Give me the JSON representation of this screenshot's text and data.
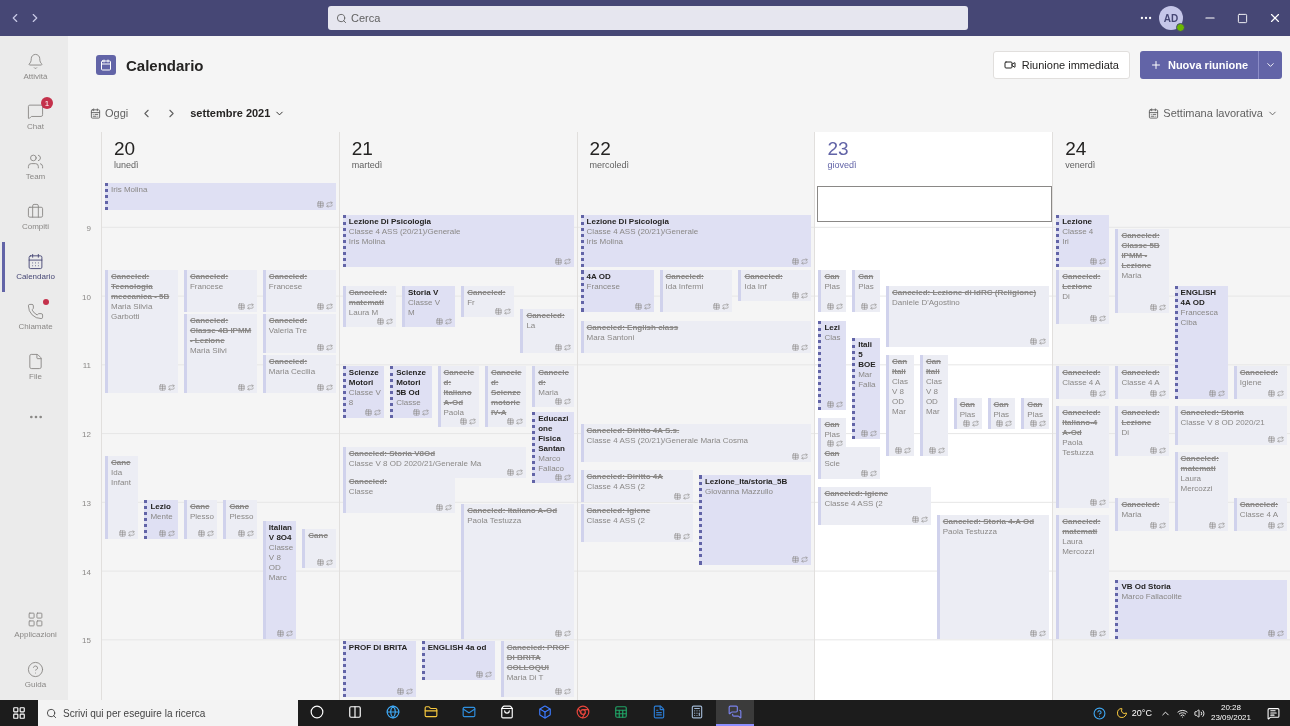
{
  "titlebar": {
    "search": {
      "placeholder": "Cerca"
    },
    "avatar": "AD"
  },
  "rail": {
    "items": [
      {
        "label": "Attività",
        "selected": false
      },
      {
        "label": "Chat",
        "selected": false,
        "badge": "1"
      },
      {
        "label": "Team",
        "selected": false
      },
      {
        "label": "Compiti",
        "selected": false
      },
      {
        "label": "Calendario",
        "selected": true
      },
      {
        "label": "Chiamate",
        "selected": false,
        "dot": true
      },
      {
        "label": "File",
        "selected": false
      }
    ],
    "bottom_items": [
      {
        "label": "Applicazioni",
        "selected": false
      },
      {
        "label": "Guida",
        "selected": false
      }
    ]
  },
  "header": {
    "title": "Calendario",
    "meet_now": "Riunione immediata",
    "new_meeting": "Nuova riunione"
  },
  "toolbar": {
    "today": "Oggi",
    "month": "settembre 2021",
    "view": "Settimana lavorativa"
  },
  "hours": [
    "9",
    "10",
    "11",
    "12",
    "13",
    "14",
    "15"
  ],
  "days": [
    {
      "number": "20",
      "weekday": "lunedì",
      "selected": false,
      "selected_slot": false,
      "events": [
        {
          "lines": [
            "Iris Molina"
          ],
          "canceled": false,
          "tentative": true
        },
        {
          "title": "Canceled: Tecnologia meccanica - 5B",
          "lines": [
            "Maria Silvia Garbotti"
          ],
          "canceled": true,
          "tentative": false
        },
        {
          "title": "Canceled:",
          "lines": [
            "Francese"
          ],
          "canceled": true,
          "tentative": false
        },
        {
          "title": "Canceled:",
          "lines": [
            "Francese"
          ],
          "canceled": true,
          "tentative": false
        },
        {
          "title": "Canceled: Classe 4B IPMM - Lezione",
          "lines": [
            "Maria Silvi"
          ],
          "canceled": true,
          "tentative": false
        },
        {
          "title": "Canceled:",
          "lines": [
            "Valeria Tre"
          ],
          "canceled": true,
          "tentative": false
        },
        {
          "title": "Canceled:",
          "lines": [
            "Maria Cecilia"
          ],
          "canceled": true,
          "tentative": false
        },
        {
          "title": "Canc",
          "lines": [
            "Ida Infant"
          ],
          "canceled": true,
          "tentative": false
        },
        {
          "title": "Lezio",
          "lines": [
            "Mente"
          ],
          "canceled": false,
          "tentative": true
        },
        {
          "title": "Canc",
          "lines": [
            "Plesso"
          ],
          "canceled": true,
          "tentative": false
        },
        {
          "title": "Canc",
          "lines": [
            "Plesso"
          ],
          "canceled": true,
          "tentative": false
        },
        {
          "title": "Italian V 8O4",
          "lines": [
            "Classe V 8 OD",
            "Marc"
          ],
          "canceled": false,
          "tentative": false
        },
        {
          "title": "Canc",
          "canceled": true,
          "tentative": false
        }
      ]
    },
    {
      "number": "21",
      "weekday": "martedì",
      "selected": false,
      "selected_slot": false,
      "events": [
        {
          "title": "Lezione Di Psicologia",
          "lines": [
            "Classe 4 ASS (20/21)/Generale",
            "Iris Molina"
          ],
          "canceled": false,
          "tentative": true
        },
        {
          "title": "Canceled: matemati",
          "lines": [
            "Laura M"
          ],
          "canceled": true,
          "tentative": false
        },
        {
          "title": "Storia V",
          "lines": [
            "Classe V",
            "M"
          ],
          "canceled": false,
          "tentative": false
        },
        {
          "title": "Canceled:",
          "lines": [
            "Fr"
          ],
          "canceled": true,
          "tentative": false
        },
        {
          "title": "Canceled:",
          "lines": [
            "La"
          ],
          "canceled": true,
          "tentative": false
        },
        {
          "title": "Scienze Motori",
          "lines": [
            "Classe V 8"
          ],
          "canceled": false,
          "tentative": true
        },
        {
          "title": "Scienze Motori 5B Od",
          "lines": [
            "Classe"
          ],
          "canceled": false,
          "tentative": true
        },
        {
          "title": "Canceled: Italiano A-Od",
          "lines": [
            "Paola"
          ],
          "canceled": true,
          "tentative": false
        },
        {
          "title": "Canceled: Scienze motorie IV-A",
          "canceled": true,
          "tentative": false
        },
        {
          "title": "Canceled:",
          "lines": [
            "Maria"
          ],
          "canceled": true,
          "tentative": false
        },
        {
          "title": "Educazione Fisica Santan",
          "lines": [
            "Marco Fallaco"
          ],
          "canceled": false,
          "tentative": true
        },
        {
          "title": "Canceled: Storia V8Od",
          "lines": [
            "Classe V 8 OD 2020/21/Generale Ma"
          ],
          "canceled": true,
          "tentative": false
        },
        {
          "title": "Canceled:",
          "lines": [
            "Classe"
          ],
          "canceled": true,
          "tentative": false
        },
        {
          "title": "Canceled: Italiano A-Od",
          "lines": [
            "Paola Testuzza"
          ],
          "canceled": true,
          "tentative": false
        },
        {
          "title": "PROF DI BRITA",
          "canceled": false,
          "tentative": true
        },
        {
          "title": "ENGLISH 4a od",
          "canceled": false,
          "tentative": true
        },
        {
          "title": "Canceled: PROF DI BRITA COLLOQUI",
          "lines": [
            "Maria Di T"
          ],
          "canceled": true,
          "tentative": false
        }
      ]
    },
    {
      "number": "22",
      "weekday": "mercoledì",
      "selected": false,
      "selected_slot": false,
      "events": [
        {
          "title": "Lezione Di Psicologia",
          "lines": [
            "Classe 4 ASS (20/21)/Generale",
            "Iris Molina"
          ],
          "canceled": false,
          "tentative": true
        },
        {
          "title": "4A OD",
          "lines": [
            "Francese"
          ],
          "canceled": false,
          "tentative": true
        },
        {
          "title": "Canceled:",
          "lines": [
            "Ida Infermi"
          ],
          "canceled": true,
          "tentative": false
        },
        {
          "title": "Canceled:",
          "lines": [
            "Ida Inf"
          ],
          "canceled": true,
          "tentative": false
        },
        {
          "title": "Canceled: English class",
          "lines": [
            "Mara Santoni"
          ],
          "canceled": true,
          "tentative": false
        },
        {
          "title": "Canceled: Diritto 4A S.s.",
          "lines": [
            "Classe 4 ASS (20/21)/Generale  Maria Cosma"
          ],
          "canceled": true,
          "tentative": false
        },
        {
          "title": "Canceled: Diritto 4A",
          "lines": [
            "Classe 4 ASS (2"
          ],
          "canceled": true,
          "tentative": false
        },
        {
          "title": "Lezione_Ita/storia_5B",
          "lines": [
            "Giovanna Mazzullo"
          ],
          "canceled": false,
          "tentative": true
        },
        {
          "title": "Canceled: Igiene",
          "lines": [
            "Classe 4 ASS (2"
          ],
          "canceled": true,
          "tentative": false
        }
      ]
    },
    {
      "number": "23",
      "weekday": "giovedì",
      "selected": true,
      "selected_slot": true,
      "events": [
        {
          "title": "Can",
          "lines": [
            "Plas"
          ],
          "canceled": true,
          "tentative": false
        },
        {
          "title": "Can",
          "lines": [
            "Plas"
          ],
          "canceled": true,
          "tentative": false
        },
        {
          "title": "Canceled: Lezione di IdRC (Religione)",
          "lines": [
            "Daniele D'Agostino"
          ],
          "canceled": true,
          "tentative": false
        },
        {
          "title": "Lezi",
          "lines": [
            "Clas"
          ],
          "canceled": false,
          "tentative": true
        },
        {
          "title": "Itali 5 BOE",
          "lines": [
            "Mar",
            "Falla"
          ],
          "canceled": false,
          "tentative": true
        },
        {
          "title": "Can Itali",
          "lines": [
            "Clas V 8 OD",
            "Mar"
          ],
          "canceled": true,
          "tentative": false
        },
        {
          "title": "Can Itali",
          "lines": [
            "Clas V 8 OD",
            "Mar"
          ],
          "canceled": true,
          "tentative": false
        },
        {
          "title": "Can",
          "lines": [
            "Plas"
          ],
          "canceled": true,
          "tentative": false
        },
        {
          "title": "Can",
          "lines": [
            "Plas"
          ],
          "canceled": true,
          "tentative": false
        },
        {
          "title": "Can",
          "lines": [
            "Plas"
          ],
          "canceled": true,
          "tentative": false
        },
        {
          "title": "Can",
          "lines": [
            "Plas"
          ],
          "canceled": true,
          "tentative": false
        },
        {
          "title": "Can",
          "lines": [
            "Scie"
          ],
          "canceled": true,
          "tentative": false
        },
        {
          "title": "Canceled: Igiene",
          "lines": [
            "Classe 4 ASS (2"
          ],
          "canceled": true,
          "tentative": false
        },
        {
          "title": "Canceled: Storia 4-A Od",
          "lines": [
            "Paola Testuzza"
          ],
          "canceled": true,
          "tentative": false
        }
      ]
    },
    {
      "number": "24",
      "weekday": "venerdì",
      "selected": false,
      "selected_slot": false,
      "events": [
        {
          "title": "Lezione",
          "lines": [
            "Classe 4",
            "Iri"
          ],
          "canceled": false,
          "tentative": true
        },
        {
          "title": "Canceled: Classe 5B IPMM - Lezione",
          "lines": [
            "Maria"
          ],
          "canceled": true,
          "tentative": false
        },
        {
          "title": "Canceled: Lezione",
          "lines": [
            "Di"
          ],
          "canceled": true,
          "tentative": false
        },
        {
          "title": "ENGLISH 4A OD",
          "lines": [
            "Francesca Ciba"
          ],
          "canceled": false,
          "tentative": true
        },
        {
          "title": "Canceled:",
          "lines": [
            "Classe 4 A"
          ],
          "canceled": true,
          "tentative": false
        },
        {
          "title": "Canceled:",
          "lines": [
            "Classe 4 A"
          ],
          "canceled": true,
          "tentative": false
        },
        {
          "title": "Canceled:",
          "lines": [
            "Igiene"
          ],
          "canceled": true,
          "tentative": false
        },
        {
          "title": "Canceled: Italiano-4 A-Od",
          "lines": [
            "Paola Testuzza"
          ],
          "canceled": true,
          "tentative": false
        },
        {
          "title": "Canceled: Lezione",
          "lines": [
            "Di"
          ],
          "canceled": true,
          "tentative": false
        },
        {
          "title": "Canceled: Storia",
          "lines": [
            "Classe V 8 OD 2020/21"
          ],
          "canceled": true,
          "tentative": false
        },
        {
          "title": "Canceled: matemati",
          "lines": [
            "Laura Mercozzi"
          ],
          "canceled": true,
          "tentative": false
        },
        {
          "title": "Canceled:",
          "lines": [
            "Maria"
          ],
          "canceled": true,
          "tentative": false
        },
        {
          "title": "Canceled:",
          "lines": [
            "Classe 4 A"
          ],
          "canceled": true,
          "tentative": false
        },
        {
          "title": "Canceled: matemati",
          "lines": [
            "Laura Mercozzi"
          ],
          "canceled": true,
          "tentative": false
        },
        {
          "title": "VB Od Storia",
          "lines": [
            "Marco Fallacolite"
          ],
          "canceled": false,
          "tentative": true
        }
      ]
    }
  ],
  "taskbar": {
    "search": {
      "placeholder": "Scrivi qui per eseguire la ricerca"
    },
    "apps": [
      {
        "selected": false
      },
      {
        "selected": false
      },
      {
        "selected": false
      },
      {
        "selected": false
      },
      {
        "selected": false
      },
      {
        "selected": false
      },
      {
        "selected": false
      },
      {
        "selected": false
      },
      {
        "selected": false
      },
      {
        "selected": false
      },
      {
        "selected": false
      },
      {
        "selected": true
      }
    ],
    "weather": "20°C",
    "time": "20:28",
    "date": "23/09/2021"
  }
}
